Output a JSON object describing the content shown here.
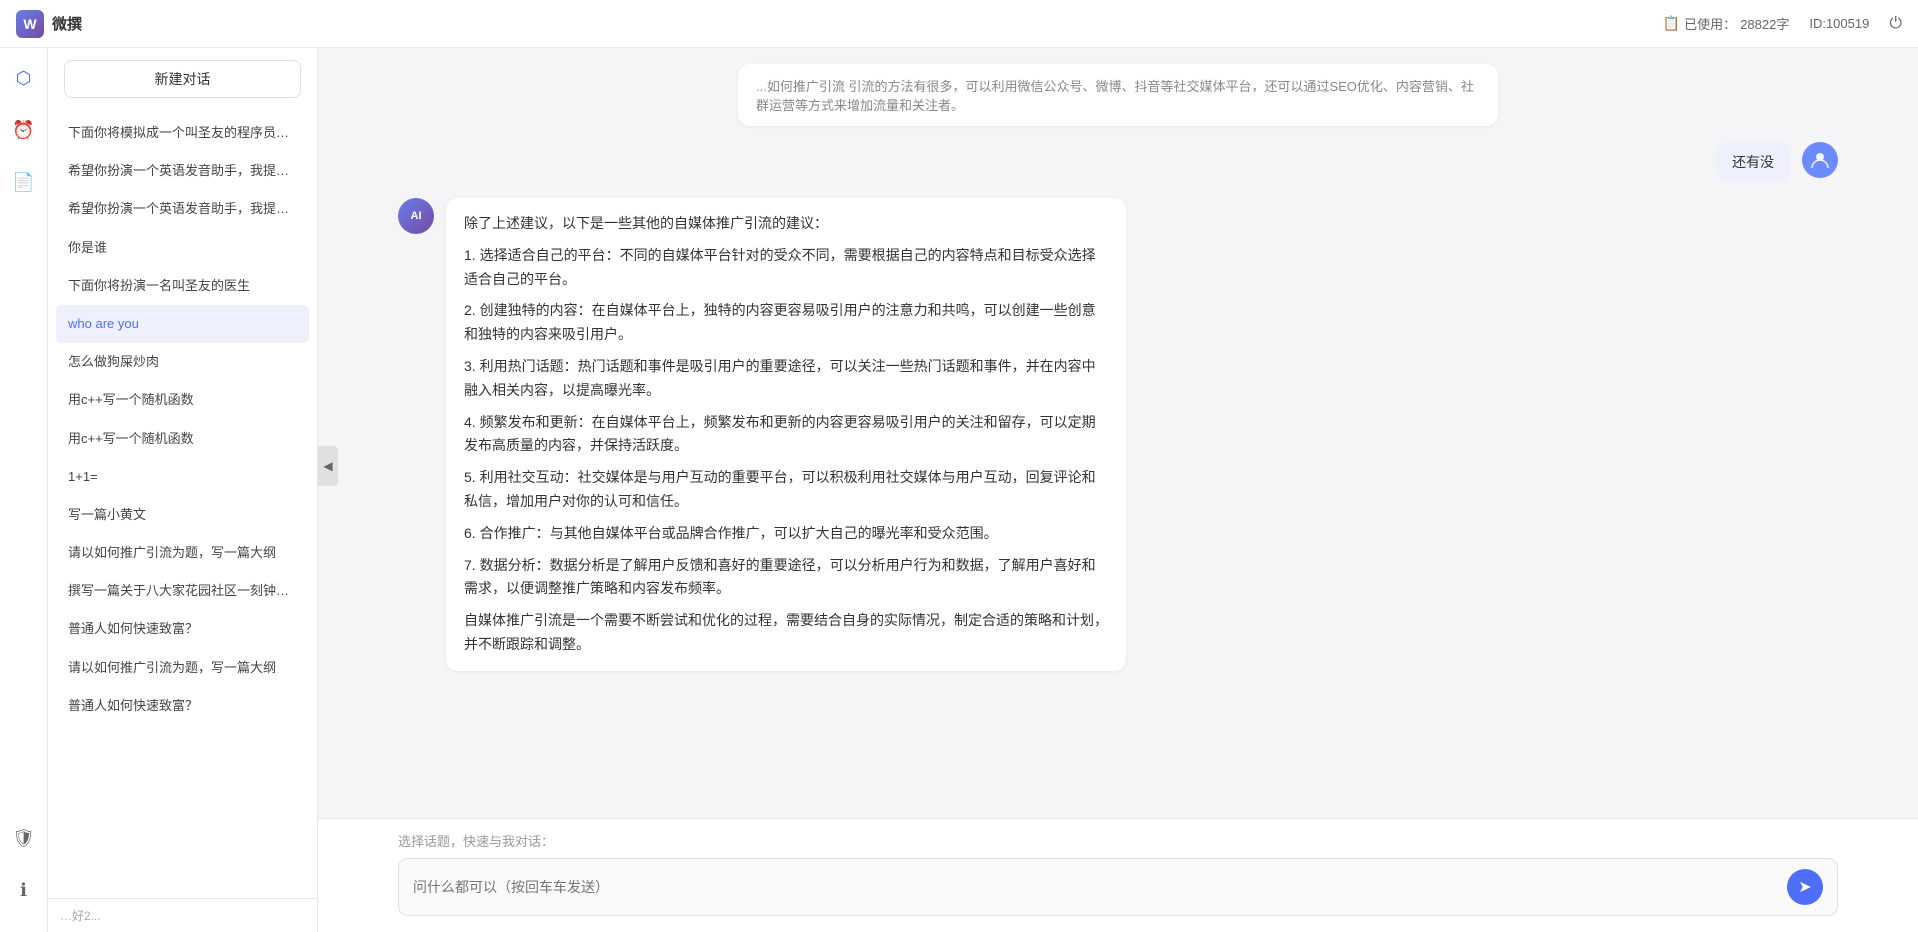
{
  "topbar": {
    "logo": "微撰",
    "usage_label": "已使用：",
    "usage_count": "28822字",
    "id_label": "ID:100519"
  },
  "sidebar": {
    "new_btn": "新建对话",
    "items": [
      {
        "id": 1,
        "label": "下面你将模拟成一个叫圣友的程序员，我说..."
      },
      {
        "id": 2,
        "label": "希望你扮演一个英语发音助手，我提供给你..."
      },
      {
        "id": 3,
        "label": "希望你扮演一个英语发音助手，我提供给你..."
      },
      {
        "id": 4,
        "label": "你是谁"
      },
      {
        "id": 5,
        "label": "下面你将扮演一名叫圣友的医生"
      },
      {
        "id": 6,
        "label": "who are you",
        "active": true
      },
      {
        "id": 7,
        "label": "怎么做狗屎炒肉"
      },
      {
        "id": 8,
        "label": "用c++写一个随机函数"
      },
      {
        "id": 9,
        "label": "用c++写一个随机函数"
      },
      {
        "id": 10,
        "label": "1+1="
      },
      {
        "id": 11,
        "label": "写一篇小黄文"
      },
      {
        "id": 12,
        "label": "请以如何推广引流为题，写一篇大纲"
      },
      {
        "id": 13,
        "label": "撰写一篇关于八大家花园社区一刻钟便民生..."
      },
      {
        "id": 14,
        "label": "普通人如何快速致富？"
      },
      {
        "id": 15,
        "label": "请以如何推广引流为题，写一篇大纲"
      },
      {
        "id": 16,
        "label": "普通人如何快速致富？"
      }
    ],
    "bottom_text": "…好2..."
  },
  "chat": {
    "truncated_text": "...如何推广引流  引流的方法有很多，可以利用微信公众号、微博、抖音等社交媒体平台，还可以通过SEO优化、内容营销、社群运营等方式来增加流量和关注者。",
    "user_message": "还有没",
    "ai_response": {
      "intro": "除了上述建议，以下是一些其他的自媒体推广引流的建议：",
      "points": [
        "1. 选择适合自己的平台：不同的自媒体平台针对的受众不同，需要根据自己的内容特点和目标受众选择适合自己的平台。",
        "2. 创建独特的内容：在自媒体平台上，独特的内容更容易吸引用户的注意力和共鸣，可以创建一些创意和独特的内容来吸引用户。",
        "3. 利用热门话题：热门话题和事件是吸引用户的重要途径，可以关注一些热门话题和事件，并在内容中融入相关内容，以提高曝光率。",
        "4. 频繁发布和更新：在自媒体平台上，频繁发布和更新的内容更容易吸引用户的关注和留存，可以定期发布高质量的内容，并保持活跃度。",
        "5. 利用社交互动：社交媒体是与用户互动的重要平台，可以积极利用社交媒体与用户互动，回复评论和私信，增加用户对你的认可和信任。",
        "6. 合作推广：与其他自媒体平台或品牌合作推广，可以扩大自己的曝光率和受众范围。",
        "7. 数据分析：数据分析是了解用户反馈和喜好的重要途径，可以分析用户行为和数据，了解用户喜好和需求，以便调整推广策略和内容发布频率。"
      ],
      "conclusion": "自媒体推广引流是一个需要不断尝试和优化的过程，需要结合自身的实际情况，制定合适的策略和计划，并不断跟踪和调整。"
    }
  },
  "input": {
    "quick_label": "选择话题，快速与我对话：",
    "placeholder": "问什么都可以（按回车车发送）"
  },
  "icons": {
    "logo_w": "W",
    "hexagon": "⬡",
    "clock": "⏰",
    "doc": "📄",
    "shield": "🛡",
    "info": "ℹ",
    "power": "⏻",
    "collapse": "◀",
    "send": "➤",
    "document_icon": "📋",
    "user_initial": "用",
    "ai_initial": "AI"
  }
}
